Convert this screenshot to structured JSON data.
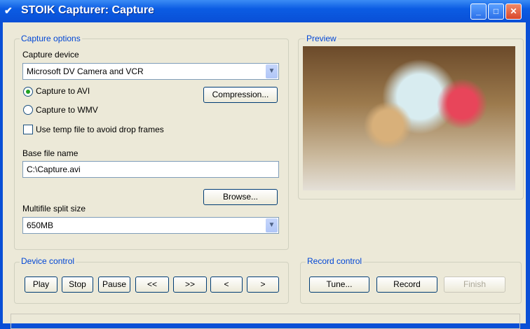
{
  "window": {
    "title": "STOIK Capturer: Capture",
    "minimize": "_",
    "maximize": "□",
    "close": "✕"
  },
  "capture_options": {
    "label": "Capture options",
    "device_label": "Capture device",
    "device_value": "Microsoft DV Camera and VCR",
    "radio_avi": "Capture to AVI",
    "radio_wmv": "Capture to WMV",
    "selected": "avi",
    "compression_button": "Compression...",
    "temp_file_label": "Use temp file to avoid drop frames",
    "temp_file_checked": false,
    "base_file_label": "Base file name",
    "base_file_value": "C:\\Capture.avi",
    "browse_button": "Browse...",
    "split_label": "Multifile split size",
    "split_value": "650MB"
  },
  "preview": {
    "label": "Preview"
  },
  "device_control": {
    "label": "Device control",
    "buttons": [
      "Play",
      "Stop",
      "Pause",
      "<<",
      ">>",
      "<",
      ">"
    ]
  },
  "record_control": {
    "label": "Record control",
    "tune": "Tune...",
    "record": "Record",
    "finish": "Finish"
  }
}
